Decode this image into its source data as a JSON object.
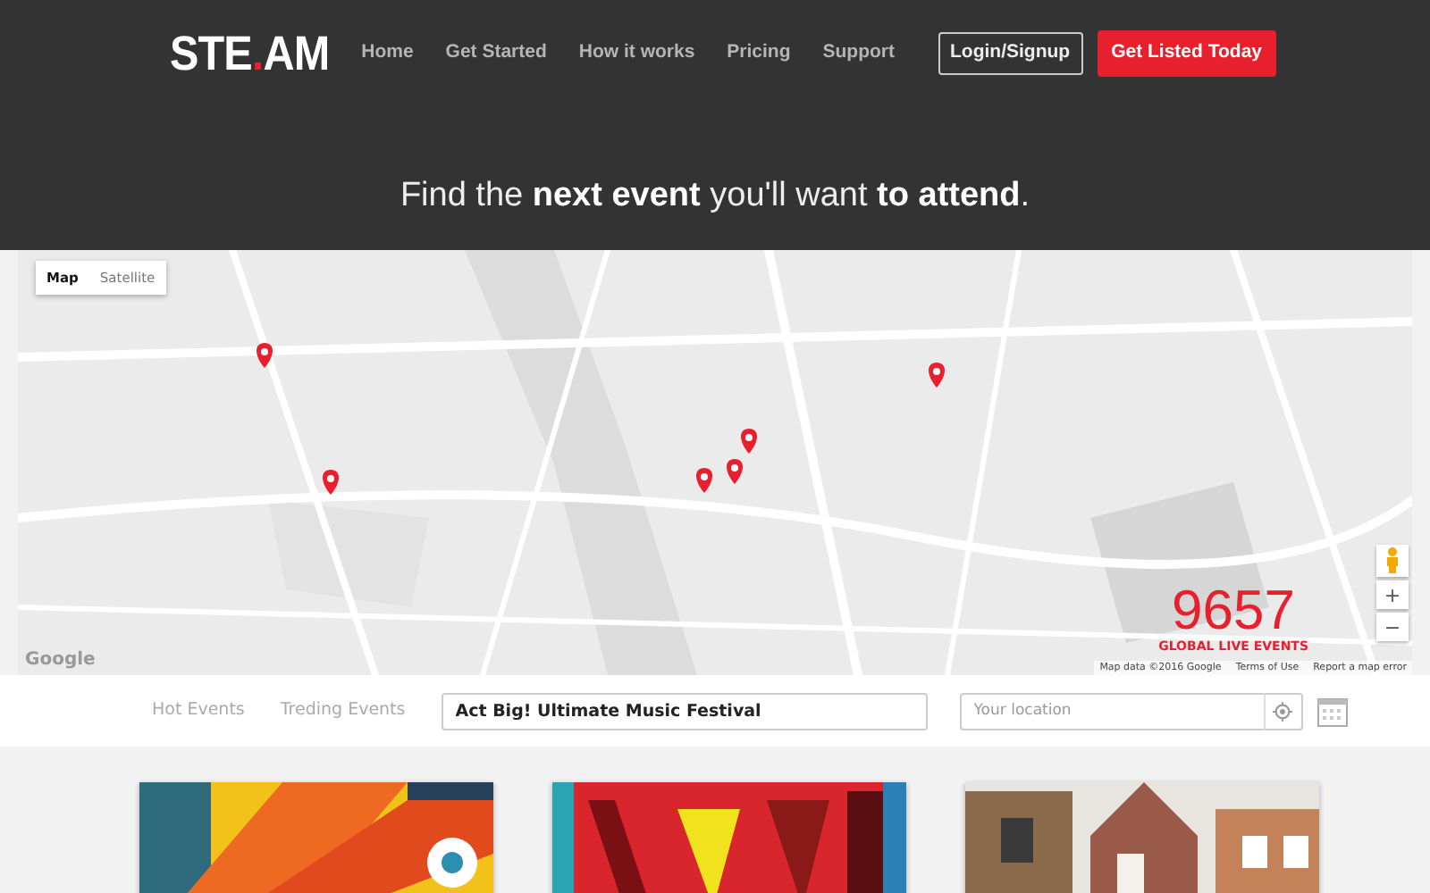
{
  "logo": {
    "parts": [
      {
        "text": "STE",
        "accent": false
      },
      {
        "text": ".",
        "accent": true
      },
      {
        "text": "AM",
        "accent": false
      }
    ]
  },
  "nav": {
    "links": [
      "Home",
      "Get Started",
      "How it works",
      "Pricing",
      "Support"
    ],
    "login": "Login/Signup",
    "cta": "Get Listed Today"
  },
  "hero": {
    "headline": "Find the **next event** you'll want **to attend**."
  },
  "map": {
    "types": [
      {
        "label": "Map",
        "selected": true
      },
      {
        "label": "Satellite",
        "selected": false
      }
    ],
    "counter": {
      "number": "9657",
      "caption": "GLOBAL LIVE EVENTS"
    },
    "zoom": [
      "+",
      "−"
    ],
    "google": "Google",
    "attribution": [
      "Map data ©2016 Google",
      "Terms of Use",
      "Report a map error"
    ]
  },
  "filters": {
    "tabs": [
      "Hot Events",
      "Treding Events"
    ],
    "search": {
      "value": "Act Big! Ultimate Music Festival"
    },
    "location": {
      "placeholder": "Your location"
    }
  }
}
